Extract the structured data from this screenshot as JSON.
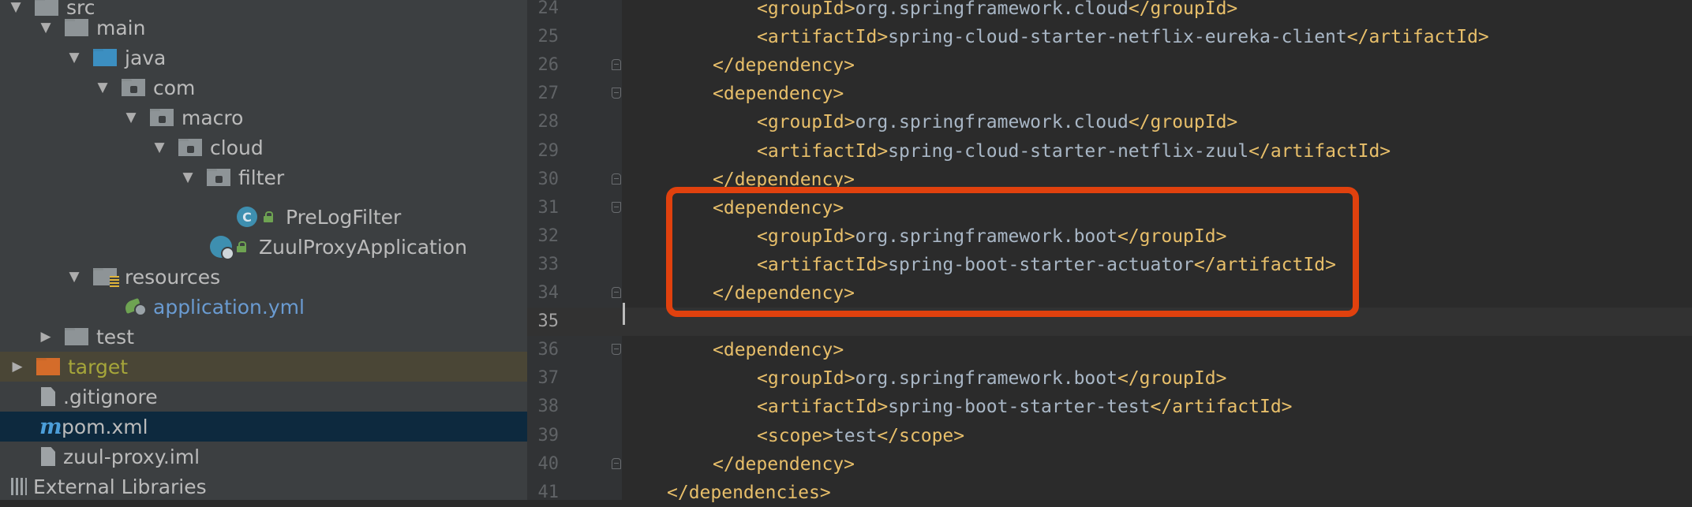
{
  "project_tree": {
    "items": [
      {
        "label": "src",
        "icon": "folder-icon",
        "expanded": true
      },
      {
        "label": "main",
        "icon": "folder-icon",
        "expanded": true
      },
      {
        "label": "java",
        "icon": "source-folder-icon",
        "expanded": true
      },
      {
        "label": "com",
        "icon": "package-icon",
        "expanded": true
      },
      {
        "label": "macro",
        "icon": "package-icon",
        "expanded": true
      },
      {
        "label": "cloud",
        "icon": "package-icon",
        "expanded": true
      },
      {
        "label": "filter",
        "icon": "package-icon",
        "expanded": true
      },
      {
        "label": "PreLogFilter",
        "icon": "java-class-icon",
        "badge": "C"
      },
      {
        "label": "ZuulProxyApplication",
        "icon": "spring-boot-app-icon"
      },
      {
        "label": "resources",
        "icon": "resources-folder-icon",
        "expanded": true
      },
      {
        "label": "application.yml",
        "icon": "spring-config-icon"
      },
      {
        "label": "test",
        "icon": "folder-icon",
        "expanded": false
      },
      {
        "label": "target",
        "icon": "excluded-folder-icon",
        "expanded": false
      },
      {
        "label": ".gitignore",
        "icon": "file-icon"
      },
      {
        "label": "pom.xml",
        "icon": "maven-icon",
        "badge": "m",
        "selected": true
      },
      {
        "label": "zuul-proxy.iml",
        "icon": "file-icon"
      },
      {
        "label": "External Libraries",
        "icon": "libraries-icon"
      }
    ]
  },
  "editor": {
    "lines": [
      {
        "num": "24",
        "indent": 2,
        "open": "<groupId>",
        "text": "org.springframework.cloud",
        "close": "</groupId>"
      },
      {
        "num": "25",
        "indent": 2,
        "open": "<artifactId>",
        "text": "spring-cloud-starter-netflix-eureka-client",
        "close": "</artifactId>"
      },
      {
        "num": "26",
        "indent": 1,
        "open": "</dependency>",
        "text": "",
        "close": ""
      },
      {
        "num": "27",
        "indent": 1,
        "open": "<dependency>",
        "text": "",
        "close": ""
      },
      {
        "num": "28",
        "indent": 2,
        "open": "<groupId>",
        "text": "org.springframework.cloud",
        "close": "</groupId>"
      },
      {
        "num": "29",
        "indent": 2,
        "open": "<artifactId>",
        "text": "spring-cloud-starter-netflix-zuul",
        "close": "</artifactId>"
      },
      {
        "num": "30",
        "indent": 1,
        "open": "</dependency>",
        "text": "",
        "close": ""
      },
      {
        "num": "31",
        "indent": 1,
        "open": "<dependency>",
        "text": "",
        "close": ""
      },
      {
        "num": "32",
        "indent": 2,
        "open": "<groupId>",
        "text": "org.springframework.boot",
        "close": "</groupId>"
      },
      {
        "num": "33",
        "indent": 2,
        "open": "<artifactId>",
        "text": "spring-boot-starter-actuator",
        "close": "</artifactId>"
      },
      {
        "num": "34",
        "indent": 1,
        "open": "</dependency>",
        "text": "",
        "close": ""
      },
      {
        "num": "35",
        "indent": 0,
        "open": "",
        "text": "",
        "close": "",
        "current": true
      },
      {
        "num": "36",
        "indent": 1,
        "open": "<dependency>",
        "text": "",
        "close": ""
      },
      {
        "num": "37",
        "indent": 2,
        "open": "<groupId>",
        "text": "org.springframework.boot",
        "close": "</groupId>"
      },
      {
        "num": "38",
        "indent": 2,
        "open": "<artifactId>",
        "text": "spring-boot-starter-test",
        "close": "</artifactId>"
      },
      {
        "num": "39",
        "indent": 2,
        "open": "<scope>",
        "text": "test",
        "close": "</scope>"
      },
      {
        "num": "40",
        "indent": 1,
        "open": "</dependency>",
        "text": "",
        "close": ""
      },
      {
        "num": "41",
        "indent": 0,
        "open": "</dependencies>",
        "text": "",
        "close": ""
      }
    ]
  },
  "colors": {
    "tree_background": "#3c3f41",
    "editor_background": "#2b2b2b",
    "xml_tag": "#e8bf6a",
    "xml_text": "#a9b7c6",
    "highlight_box": "#e0410e",
    "selection": "#0d293e"
  }
}
